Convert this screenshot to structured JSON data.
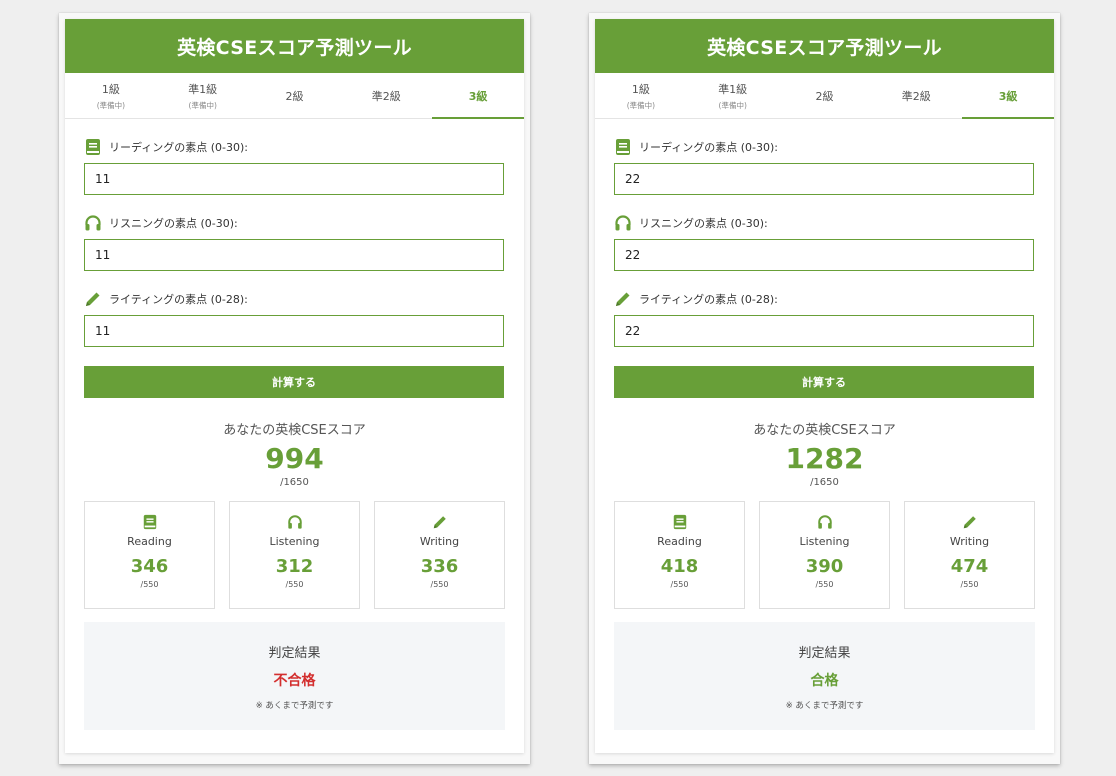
{
  "colors": {
    "brand": "#689f38",
    "fail": "#d32f2f",
    "pass": "#689f38"
  },
  "icons": {
    "reading": "book-icon",
    "listening": "headphones-icon",
    "writing": "pencil-icon"
  },
  "panels": [
    {
      "title": "英検CSEスコア予測ツール",
      "tabs": [
        {
          "label": "1級",
          "sub": "(準備中)"
        },
        {
          "label": "準1級",
          "sub": "(準備中)"
        },
        {
          "label": "2級",
          "sub": ""
        },
        {
          "label": "準2級",
          "sub": ""
        },
        {
          "label": "3級",
          "sub": "",
          "active": true
        }
      ],
      "fields": {
        "reading": {
          "label": "リーディングの素点 (0-30):",
          "value": "11"
        },
        "listening": {
          "label": "リスニングの素点 (0-30):",
          "value": "11"
        },
        "writing": {
          "label": "ライティングの素点 (0-28):",
          "value": "11"
        }
      },
      "button_label": "計算する",
      "score": {
        "label": "あなたの英検CSEスコア",
        "total": "994",
        "max": "/1650"
      },
      "sections": [
        {
          "name": "Reading",
          "value": "346",
          "max": "/550"
        },
        {
          "name": "Listening",
          "value": "312",
          "max": "/550"
        },
        {
          "name": "Writing",
          "value": "336",
          "max": "/550"
        }
      ],
      "result": {
        "label": "判定結果",
        "value": "不合格",
        "note": "※ あくまで予測です",
        "status": "fail"
      }
    },
    {
      "title": "英検CSEスコア予測ツール",
      "tabs": [
        {
          "label": "1級",
          "sub": "(準備中)"
        },
        {
          "label": "準1級",
          "sub": "(準備中)"
        },
        {
          "label": "2級",
          "sub": ""
        },
        {
          "label": "準2級",
          "sub": ""
        },
        {
          "label": "3級",
          "sub": "",
          "active": true
        }
      ],
      "fields": {
        "reading": {
          "label": "リーディングの素点 (0-30):",
          "value": "22"
        },
        "listening": {
          "label": "リスニングの素点 (0-30):",
          "value": "22"
        },
        "writing": {
          "label": "ライティングの素点 (0-28):",
          "value": "22"
        }
      },
      "button_label": "計算する",
      "score": {
        "label": "あなたの英検CSEスコア",
        "total": "1282",
        "max": "/1650"
      },
      "sections": [
        {
          "name": "Reading",
          "value": "418",
          "max": "/550"
        },
        {
          "name": "Listening",
          "value": "390",
          "max": "/550"
        },
        {
          "name": "Writing",
          "value": "474",
          "max": "/550"
        }
      ],
      "result": {
        "label": "判定結果",
        "value": "合格",
        "note": "※ あくまで予測です",
        "status": "pass"
      }
    }
  ]
}
